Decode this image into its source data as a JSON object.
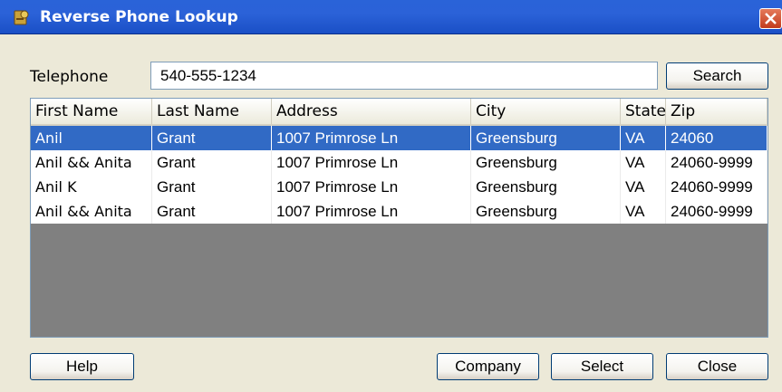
{
  "window": {
    "title": "Reverse Phone Lookup",
    "app_icon": "phone-book-icon",
    "close_icon": "close-icon"
  },
  "telephone": {
    "label": "Telephone",
    "value": "540-555-1234"
  },
  "buttons": {
    "search": "Search",
    "help": "Help",
    "company": "Company",
    "select": "Select",
    "close": "Close"
  },
  "table": {
    "columns": [
      "First Name",
      "Last Name",
      "Address",
      "City",
      "State",
      "Zip"
    ],
    "rows": [
      [
        "Anil",
        "Grant",
        "1007 Primrose Ln",
        "Greensburg",
        "VA",
        "24060"
      ],
      [
        "Anil && Anita",
        "Grant",
        "1007 Primrose Ln",
        "Greensburg",
        "VA",
        "24060-9999"
      ],
      [
        "Anil K",
        "Grant",
        "1007 Primrose Ln",
        "Greensburg",
        "VA",
        "24060-9999"
      ],
      [
        "Anil && Anita",
        "Grant",
        "1007 Primrose Ln",
        "Greensburg",
        "VA",
        "24060-9999"
      ]
    ],
    "selected_row": 0
  },
  "colors": {
    "selection": "#316ac5",
    "title_bar": "#2a63d8",
    "list_background": "#808080"
  }
}
